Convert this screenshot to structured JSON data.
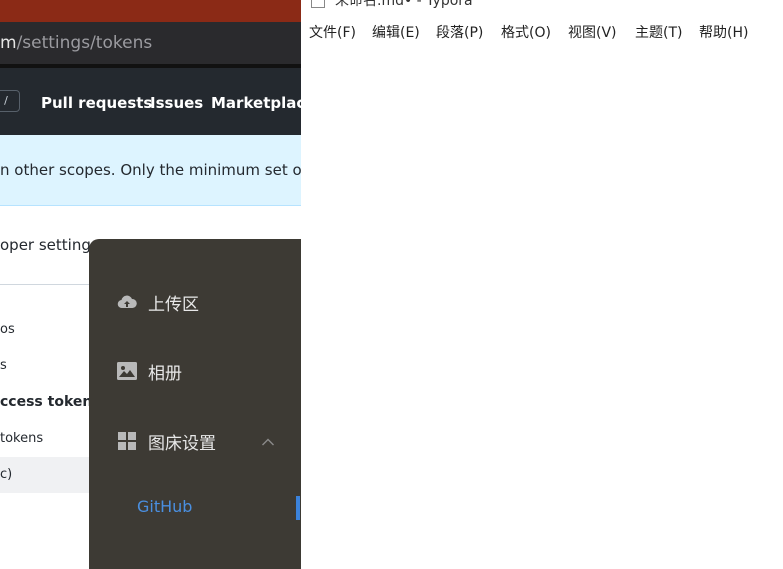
{
  "browser": {
    "url": {
      "host": "m",
      "path": "/settings/tokens"
    },
    "search_key": "/",
    "nav": [
      "Pull requests",
      "Issues",
      "Marketplace"
    ],
    "flash": "n other scopes. Only the minimum set of ne",
    "title": "oper settings",
    "sidebar": [
      "os",
      "s",
      "ccess tokens",
      "tokens",
      "c)"
    ]
  },
  "uploader": {
    "items": [
      {
        "label": "上传区",
        "icon": "cloud-upload-icon"
      },
      {
        "label": "相册",
        "icon": "image-icon"
      },
      {
        "label": "图床设置",
        "icon": "grid-icon"
      }
    ],
    "sub_item": "GitHub",
    "colors": {
      "background": "#3d3a34",
      "active": "#4a8fe0"
    }
  },
  "typora": {
    "title": "未命名.md• - Typora",
    "menu": [
      "文件(F)",
      "编辑(E)",
      "段落(P)",
      "格式(O)",
      "视图(V)",
      "主题(T)",
      "帮助(H)"
    ]
  }
}
